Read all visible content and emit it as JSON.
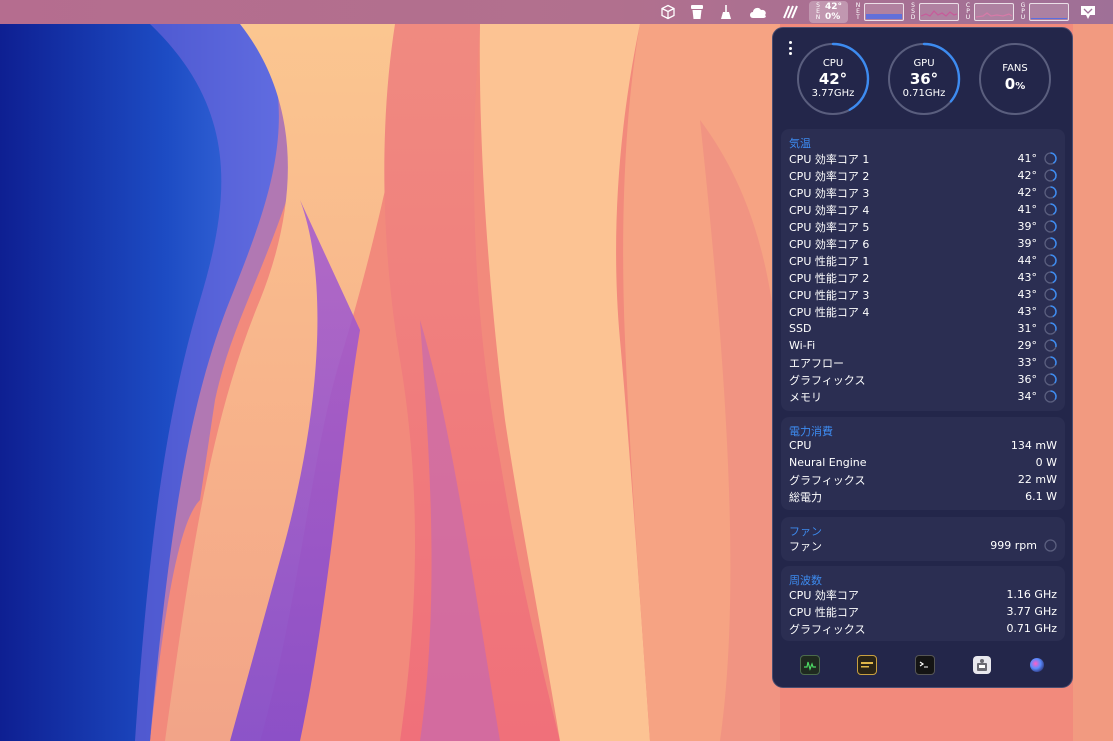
{
  "menubar": {
    "sensors_label": "SEN",
    "sensors_temp": "42°",
    "sensors_pct": "0%",
    "graphs": [
      {
        "label": "NET",
        "color": "#5a6ee0"
      },
      {
        "label": "SSD",
        "color": "#c85a9a"
      },
      {
        "label": "CPU",
        "color": "#d77aa8"
      },
      {
        "label": "GPU",
        "color": "#5a6ee0"
      }
    ],
    "icons": [
      "box-icon",
      "cup-icon",
      "broom-icon",
      "cloud-icon",
      "slash-logo-icon",
      "screen-icon"
    ]
  },
  "gauges": {
    "cpu": {
      "label": "CPU",
      "value": "42°",
      "sub": "3.77GHz",
      "fraction": 0.42
    },
    "gpu": {
      "label": "GPU",
      "value": "36°",
      "sub": "0.71GHz",
      "fraction": 0.36
    },
    "fans": {
      "label": "FANS",
      "value": "0",
      "unit": "%",
      "fraction": 0.0
    }
  },
  "temps": {
    "title": "気温",
    "rows": [
      {
        "name": "CPU 効率コア 1",
        "value": "41°",
        "level": 0.41
      },
      {
        "name": "CPU 効率コア 2",
        "value": "42°",
        "level": 0.42
      },
      {
        "name": "CPU 効率コア 3",
        "value": "42°",
        "level": 0.42
      },
      {
        "name": "CPU 効率コア 4",
        "value": "41°",
        "level": 0.41
      },
      {
        "name": "CPU 効率コア 5",
        "value": "39°",
        "level": 0.39
      },
      {
        "name": "CPU 効率コア 6",
        "value": "39°",
        "level": 0.39
      },
      {
        "name": "CPU 性能コア 1",
        "value": "44°",
        "level": 0.44
      },
      {
        "name": "CPU 性能コア 2",
        "value": "43°",
        "level": 0.43
      },
      {
        "name": "CPU 性能コア 3",
        "value": "43°",
        "level": 0.43
      },
      {
        "name": "CPU 性能コア 4",
        "value": "43°",
        "level": 0.43
      },
      {
        "name": "SSD",
        "value": "31°",
        "level": 0.31
      },
      {
        "name": "Wi-Fi",
        "value": "29°",
        "level": 0.29
      },
      {
        "name": "エアフロー",
        "value": "33°",
        "level": 0.33
      },
      {
        "name": "グラフィックス",
        "value": "36°",
        "level": 0.36
      },
      {
        "name": "メモリ",
        "value": "34°",
        "level": 0.34
      }
    ]
  },
  "power": {
    "title": "電力消費",
    "rows": [
      {
        "name": "CPU",
        "value": "134 mW"
      },
      {
        "name": "Neural Engine",
        "value": "0 W"
      },
      {
        "name": "グラフィックス",
        "value": "22 mW"
      },
      {
        "name": "総電力",
        "value": "6.1 W"
      }
    ]
  },
  "fans": {
    "title": "ファン",
    "rows": [
      {
        "name": "ファン",
        "value": "999 rpm",
        "level": 0.0
      }
    ]
  },
  "freq": {
    "title": "周波数",
    "rows": [
      {
        "name": "CPU 効率コア",
        "value": "1.16 GHz"
      },
      {
        "name": "CPU 性能コア",
        "value": "3.77 GHz"
      },
      {
        "name": "グラフィックス",
        "value": "0.71 GHz"
      }
    ]
  },
  "dock": {
    "apps": [
      {
        "icon": "activity-monitor-icon",
        "color": "#1f2a1f"
      },
      {
        "icon": "console-icon",
        "color": "#2a2416"
      },
      {
        "icon": "terminal-icon",
        "color": "#141414"
      },
      {
        "icon": "system-information-icon",
        "color": "#e8e8ee"
      },
      {
        "icon": "siri-icon",
        "color": "#3a3f7a"
      }
    ]
  },
  "colors": {
    "accent": "#3d8bf0",
    "panel_bg": "#23264a",
    "section_bg": "#2b2e52"
  }
}
